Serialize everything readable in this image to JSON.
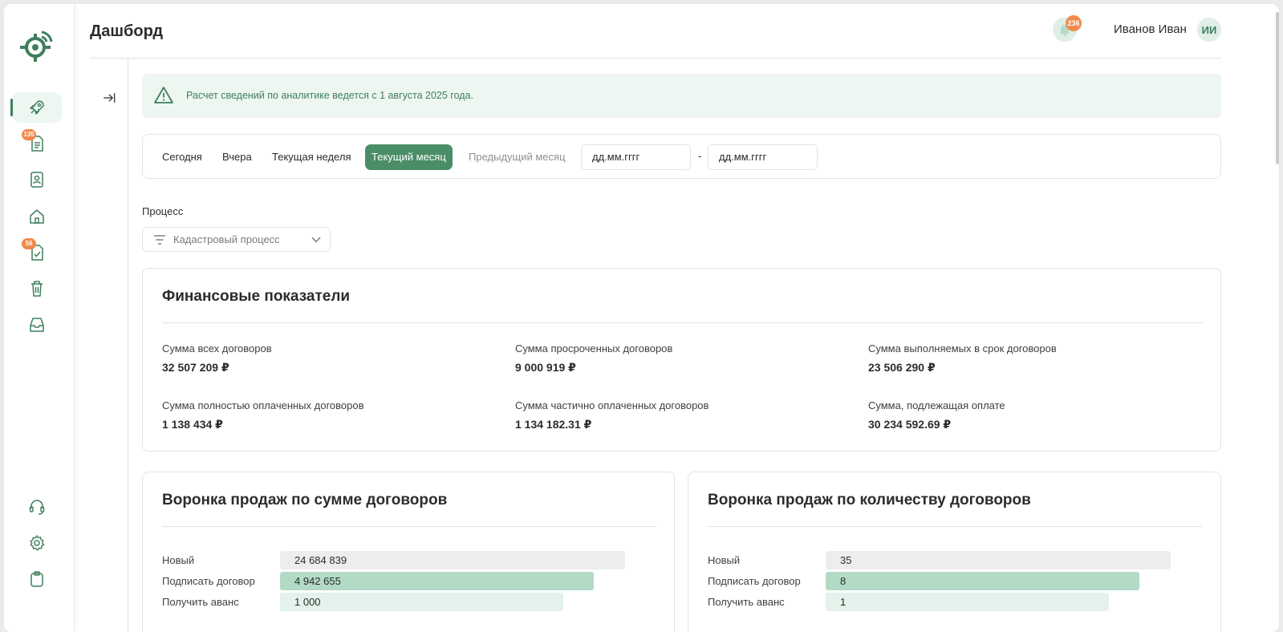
{
  "header": {
    "title": "Дашборд",
    "notifications_count": "236",
    "user_name": "Иванов Иван",
    "avatar_initials": "ИИ"
  },
  "sidebar": {
    "items": [
      {
        "icon": "rocket-icon",
        "active": true
      },
      {
        "icon": "document-list-icon",
        "badge": "135"
      },
      {
        "icon": "contact-card-icon"
      },
      {
        "icon": "home-icon"
      },
      {
        "icon": "document-check-icon",
        "badge": "56"
      },
      {
        "icon": "trash-icon"
      },
      {
        "icon": "inbox-icon"
      }
    ],
    "bottom": [
      {
        "icon": "headset-icon"
      },
      {
        "icon": "settings-icon"
      },
      {
        "icon": "clipboard-icon"
      }
    ]
  },
  "alert": {
    "text": "Расчет сведений по аналитике ведется с 1 августа 2025 года."
  },
  "period": {
    "buttons": [
      "Сегодня",
      "Вчера",
      "Текущая неделя",
      "Текущий месяц",
      "Предыдущий месяц"
    ],
    "active": "Текущий месяц",
    "date_from_placeholder": "дд.мм.гггг",
    "date_to_placeholder": "дд.мм.гггг",
    "separator": "-"
  },
  "process": {
    "label": "Процесс",
    "selected": "Кадастровый процесс"
  },
  "finance": {
    "title": "Финансовые показатели",
    "metrics": [
      {
        "label": "Сумма всех договоров",
        "value": "32 507 209 ₽"
      },
      {
        "label": "Сумма просроченных договоров",
        "value": "9 000 919 ₽"
      },
      {
        "label": "Сумма выполняемых в срок договоров",
        "value": "23 506 290 ₽"
      },
      {
        "label": "Сумма полностью оплаченных договоров",
        "value": "1 138 434 ₽"
      },
      {
        "label": "Сумма частично оплаченных договоров",
        "value": "1 134 182.31 ₽"
      },
      {
        "label": "Сумма, подлежащая оплате",
        "value": "30 234 592.69 ₽"
      }
    ]
  },
  "funnel_sum": {
    "title": "Воронка продаж по сумме договоров",
    "rows": [
      {
        "label": "Новый",
        "value": "24 684 839",
        "fill": 1.0,
        "color": "#ededed"
      },
      {
        "label": "Подписать договор",
        "value": "4 942 655",
        "fill": 0.91,
        "color": "#b3dac5"
      },
      {
        "label": "Получить аванс",
        "value": "1 000",
        "fill": 0.82,
        "color": "#e3f2ea"
      }
    ]
  },
  "funnel_count": {
    "title": "Воронка продаж по количеству договоров",
    "rows": [
      {
        "label": "Новый",
        "value": "35",
        "fill": 1.0,
        "color": "#ededed"
      },
      {
        "label": "Подписать договор",
        "value": "8",
        "fill": 0.91,
        "color": "#b3dac5"
      },
      {
        "label": "Получить аванс",
        "value": "1",
        "fill": 0.82,
        "color": "#e3f2ea"
      }
    ]
  },
  "colors": {
    "accent": "#4a8d67",
    "accent_dark": "#3e7f5d",
    "badge": "#f08a4b",
    "alert_bg": "#eef6f1"
  }
}
